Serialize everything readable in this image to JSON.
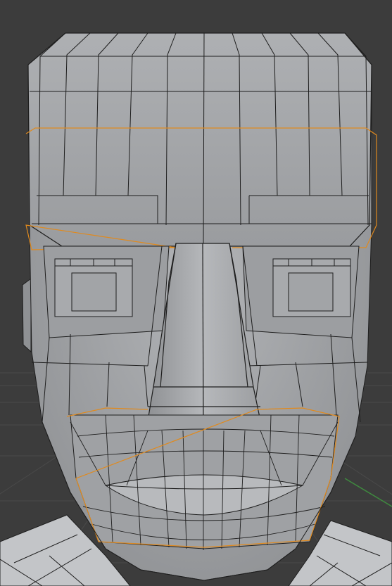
{
  "viewport": {
    "kind": "3d-modeling-viewport",
    "mode": "edit-mode",
    "shading": "solid",
    "overlays": [
      "wireframe-edges",
      "floor-grid"
    ],
    "object": "low-poly-head-mesh",
    "selection": [
      "brow-edge-loop",
      "mouth-edge-loop"
    ]
  },
  "colors": {
    "background": "#3c3c3c",
    "grid_line": "#4a4a4a",
    "mesh_face": "#a3a5a8",
    "mesh_face_dark": "#8a8c8f",
    "mesh_face_light": "#b4b6b9",
    "wire": "#1e1e1e",
    "selected_edge": "#e08a1e",
    "axis_y": "#3f8a3f"
  }
}
